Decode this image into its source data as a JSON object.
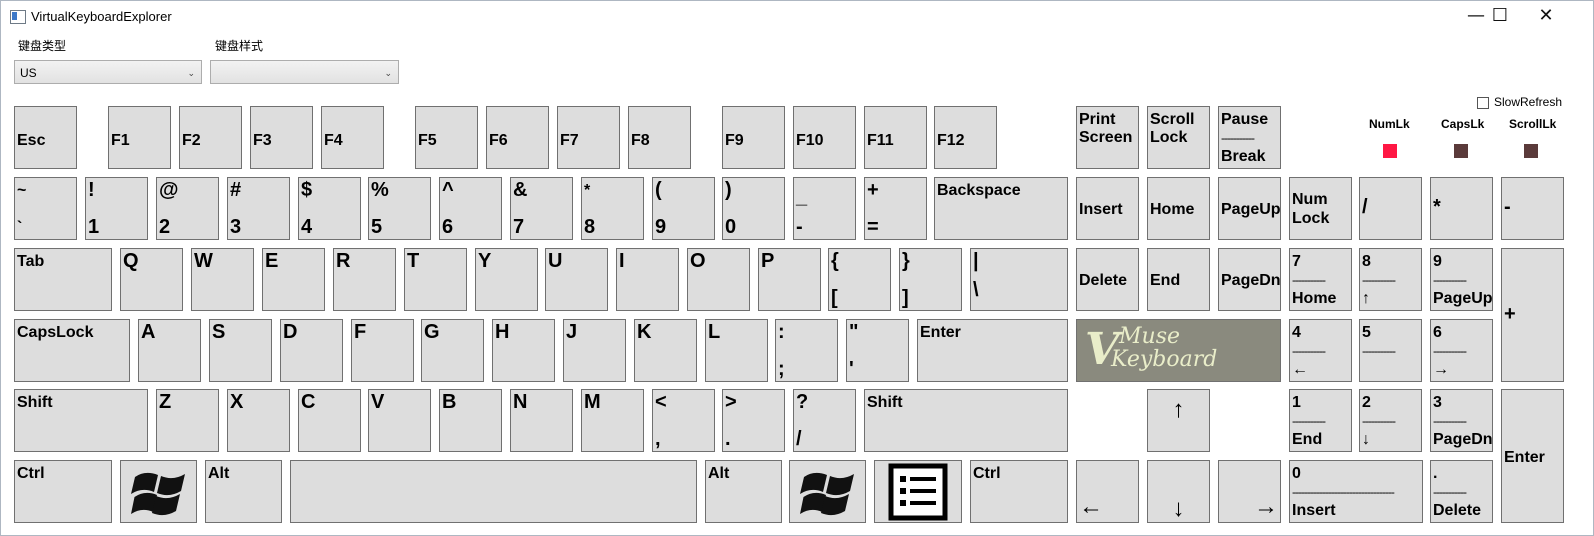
{
  "window": {
    "title": "VirtualKeyboardExplorer",
    "minimize": "—",
    "maximize": "☐",
    "close": "✕"
  },
  "controls": {
    "type_label": "键盘类型",
    "type_value": "US",
    "style_label": "键盘样式",
    "style_value": ""
  },
  "slow_refresh": "SlowRefresh",
  "indicators": {
    "numlock": {
      "label": "NumLk",
      "color": "#ff1744"
    },
    "capslock": {
      "label": "CapsLk",
      "color": "#5a3a3a"
    },
    "scrolllock": {
      "label": "ScrollLk",
      "color": "#5a3a3a"
    }
  },
  "logo": {
    "letter": "V",
    "line1": "Muse",
    "line2": "Keyboard"
  },
  "keys": {
    "esc": "Esc",
    "f1": "F1",
    "f2": "F2",
    "f3": "F3",
    "f4": "F4",
    "f5": "F5",
    "f6": "F6",
    "f7": "F7",
    "f8": "F8",
    "f9": "F9",
    "f10": "F10",
    "f11": "F11",
    "f12": "F12",
    "print_t": "Print",
    "print_b": "Screen",
    "scroll_t": "Scroll",
    "scroll_b": "Lock",
    "pause_t": "Pause",
    "pause_d": "-----------",
    "pause_b": "Break",
    "tilde_t": "~",
    "tilde_b": "`",
    "n1_t": "!",
    "n1_b": "1",
    "n2_t": "@",
    "n2_b": "2",
    "n3_t": "#",
    "n3_b": "3",
    "n4_t": "$",
    "n4_b": "4",
    "n5_t": "%",
    "n5_b": "5",
    "n6_t": "^",
    "n6_b": "6",
    "n7_t": "&",
    "n7_b": "7",
    "n8_t": "*",
    "n8_b": "8",
    "n9_t": "(",
    "n9_b": "9",
    "n0_t": ")",
    "n0_b": "0",
    "minus_t": "_",
    "minus_b": "-",
    "equal_t": "+",
    "equal_b": "=",
    "backspace": "Backspace",
    "insert": "Insert",
    "home": "Home",
    "pageup": "PageUp",
    "numlock_t": "Num",
    "numlock_b": "Lock",
    "np_div": "/",
    "np_mul": "*",
    "np_sub": "-",
    "tab": "Tab",
    "q": "Q",
    "w": "W",
    "e": "E",
    "r": "R",
    "t": "T",
    "y": "Y",
    "u": "U",
    "i": "I",
    "o": "O",
    "p": "P",
    "lbrace_t": "{",
    "lbrace_b": "[",
    "rbrace_t": "}",
    "rbrace_b": "]",
    "pipe_t": "|",
    "pipe_b": "\\",
    "delete": "Delete",
    "end": "End",
    "pagedn": "PageDn",
    "np7_t": "7",
    "np7_d": "-----------",
    "np7_b": "Home",
    "np8_t": "8",
    "np8_d": "-----------",
    "np8_b": "↑",
    "np9_t": "9",
    "np9_d": "-----------",
    "np9_b": "PageUp",
    "np_add": "+",
    "capslock": "CapsLock",
    "a": "A",
    "s": "S",
    "d": "D",
    "f": "F",
    "g": "G",
    "h": "H",
    "j": "J",
    "k": "K",
    "l": "L",
    "colon_t": ":",
    "colon_b": ";",
    "quote_t": "\"",
    "quote_b": "'",
    "enter": "Enter",
    "np4_t": "4",
    "np4_d": "-----------",
    "np4_b": "←",
    "np5_t": "5",
    "np5_d": "-----------",
    "np6_t": "6",
    "np6_d": "-----------",
    "np6_b": "→",
    "lshift": "Shift",
    "z": "Z",
    "x": "X",
    "c": "C",
    "v": "V",
    "b": "B",
    "n": "N",
    "m": "M",
    "lt_t": "<",
    "lt_b": ",",
    "gt_t": ">",
    "gt_b": ".",
    "qm_t": "?",
    "qm_b": "/",
    "rshift": "Shift",
    "up": "↑",
    "np1_t": "1",
    "np1_d": "-----------",
    "np1_b": "End",
    "np2_t": "2",
    "np2_d": "-----------",
    "np2_b": "↓",
    "np3_t": "3",
    "np3_d": "-----------",
    "np3_b": "PageDn",
    "np_enter": "Enter",
    "lctrl": "Ctrl",
    "lalt": "Alt",
    "space": "",
    "ralt": "Alt",
    "rctrl": "Ctrl",
    "left": "←",
    "down": "↓",
    "right": "→",
    "np0_t": "0",
    "np0_d": "----------------------------------",
    "np0_b": "Insert",
    "npdot_t": ".",
    "npdot_d": "-----------",
    "npdot_b": "Delete"
  }
}
